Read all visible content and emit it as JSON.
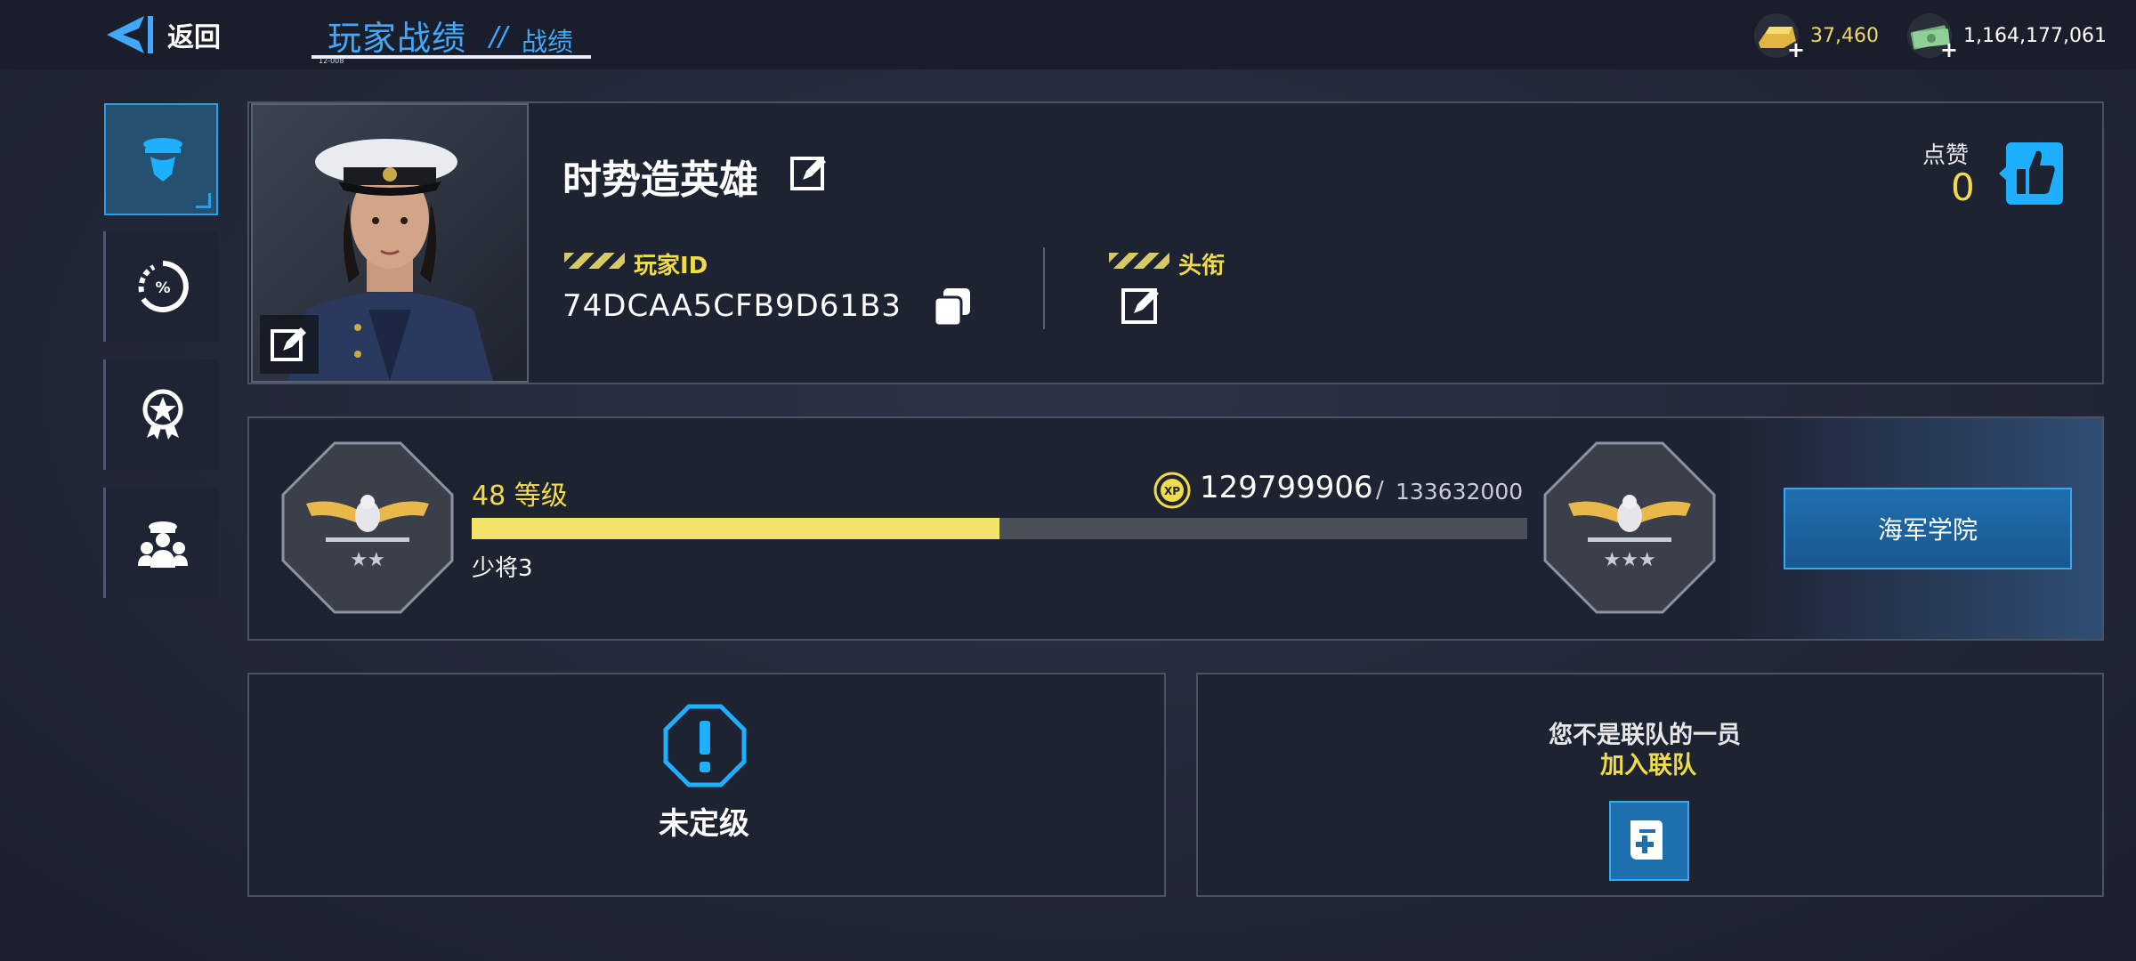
{
  "header": {
    "back_label": "返回",
    "title": "玩家战绩",
    "title_separator": "//",
    "subtitle": "战绩",
    "tiny_caption": "12-008"
  },
  "currencies": [
    {
      "icon": "gold-bar-icon",
      "value": "37,460",
      "color": "#f0d860"
    },
    {
      "icon": "cash-icon",
      "value": "1,164,177,061",
      "color": "#ffffff"
    }
  ],
  "side_tabs": [
    {
      "icon": "officer-icon",
      "active": true
    },
    {
      "icon": "percent-stats-icon",
      "active": false
    },
    {
      "icon": "medal-icon",
      "active": false
    },
    {
      "icon": "crew-icon",
      "active": false
    }
  ],
  "profile": {
    "name": "时势造英雄",
    "player_id_label": "玩家ID",
    "player_id": "74DCAA5CFB9D61B3",
    "title_label": "头衔",
    "likes_label": "点赞",
    "likes_count": "0"
  },
  "level": {
    "level_text": "48 等级",
    "xp_current": "129799906",
    "xp_separator": "/",
    "xp_max": "133632000",
    "xp_progress": 0.5,
    "rank_name": "少将3",
    "current_rank_stars": "★★",
    "next_rank_stars": "★★★",
    "academy_button": "海军学院"
  },
  "rating": {
    "status": "未定级"
  },
  "alliance": {
    "status": "您不是联队的一员",
    "join_label": "加入联队"
  },
  "colors": {
    "accent_blue": "#3fa8ff",
    "accent_yellow": "#f0dc4a",
    "button_blue": "#1e6fae"
  }
}
